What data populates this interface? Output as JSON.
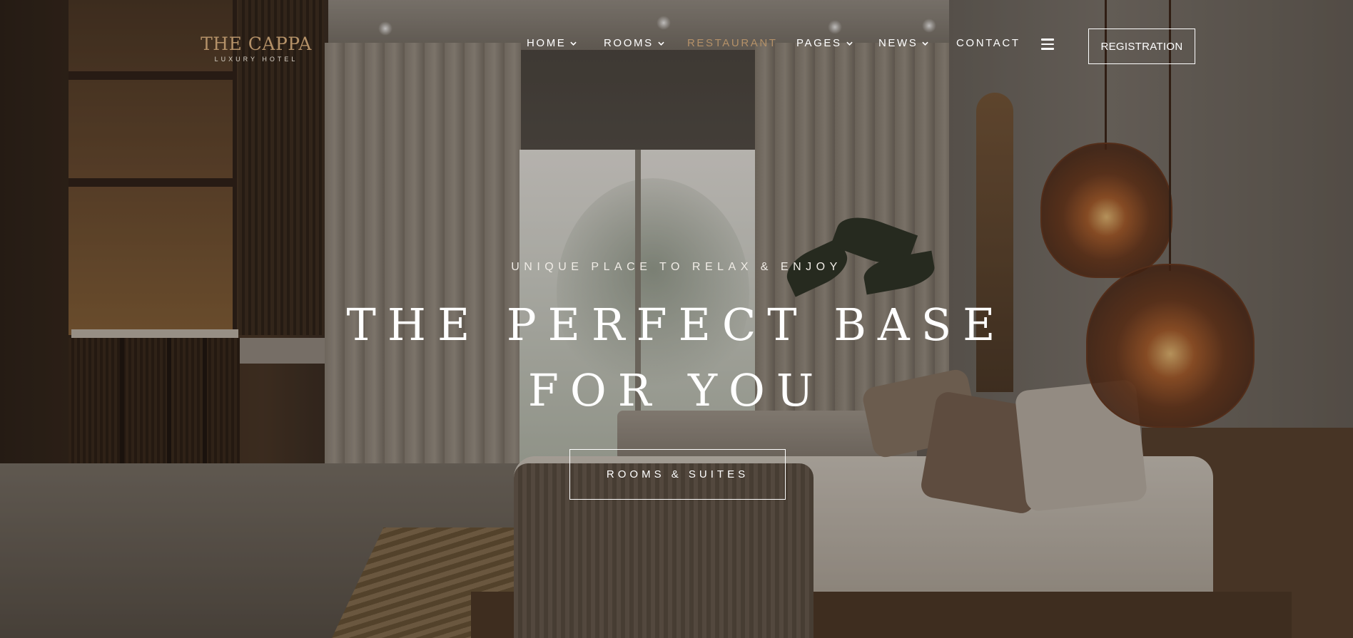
{
  "logo": {
    "title": "THE CAPPA",
    "subtitle": "LUXURY HOTEL"
  },
  "nav": {
    "items": [
      {
        "label": "HOME",
        "has_dropdown": true,
        "active": false
      },
      {
        "label": "ROOMS",
        "has_dropdown": true,
        "active": false
      },
      {
        "label": "RESTAURANT",
        "has_dropdown": false,
        "active": true
      },
      {
        "label": "PAGES",
        "has_dropdown": true,
        "active": false
      },
      {
        "label": "NEWS",
        "has_dropdown": true,
        "active": false
      },
      {
        "label": "CONTACT",
        "has_dropdown": false,
        "active": false
      }
    ],
    "menu_icon": "hamburger-menu-icon",
    "registration_label": "REGISTRATION"
  },
  "hero": {
    "subtitle": "UNIQUE PLACE TO RELAX & ENJOY",
    "title_line1": "THE PERFECT BASE",
    "title_line2": "FOR YOU",
    "button_label": "ROOMS & SUITES"
  },
  "colors": {
    "accent": "#b49168",
    "text": "#ffffff"
  }
}
